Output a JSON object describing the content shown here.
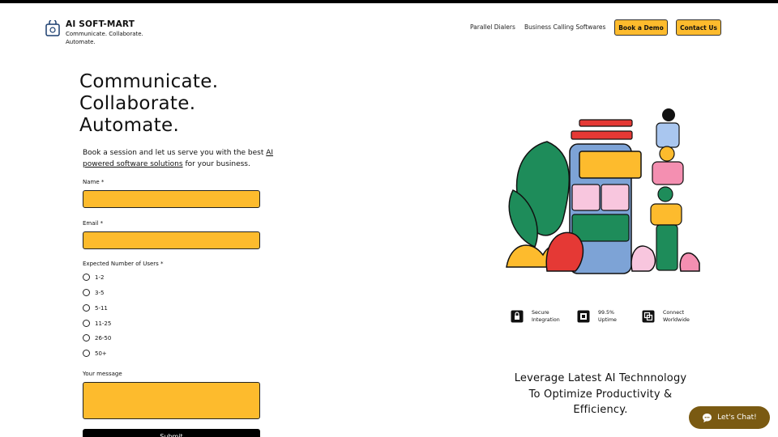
{
  "header": {
    "brand": "AI SOFT-MART",
    "tagline": "Communicate. Collaborate. Automate.",
    "nav": [
      "Parallel Dialers",
      "Business Calling Softwares"
    ],
    "book_demo": "Book a Demo",
    "contact_us": "Contact Us"
  },
  "hero": {
    "title_lines": [
      "Communicate.",
      "Collaborate.",
      "Automate."
    ],
    "intro_pre": "Book a session and let us serve you with the best ",
    "intro_link": "AI powered software solutions",
    "intro_post": " for your business."
  },
  "form": {
    "name_label": "Name *",
    "email_label": "Email *",
    "users_label": "Expected Number of Users *",
    "user_options": [
      "1-2",
      "3-5",
      "5-11",
      "11-25",
      "26-50",
      "50+"
    ],
    "message_label": "Your message",
    "submit_label": "Submit"
  },
  "features": [
    {
      "icon": "lock-icon",
      "line1": "Secure",
      "line2": "Integration"
    },
    {
      "icon": "uptime-icon",
      "line1": "99.5%",
      "line2": "Uptime"
    },
    {
      "icon": "connect-icon",
      "line1": "Connect",
      "line2": "Worldwide"
    }
  ],
  "leverage": [
    "Leverage Latest AI Technnology",
    "To Optimize Productivity &",
    "Efficiency."
  ],
  "chat": {
    "label": "Let's Chat!"
  },
  "colors": {
    "accent": "#fdbb2d",
    "dark": "#000000",
    "chat": "#7a5a12"
  }
}
